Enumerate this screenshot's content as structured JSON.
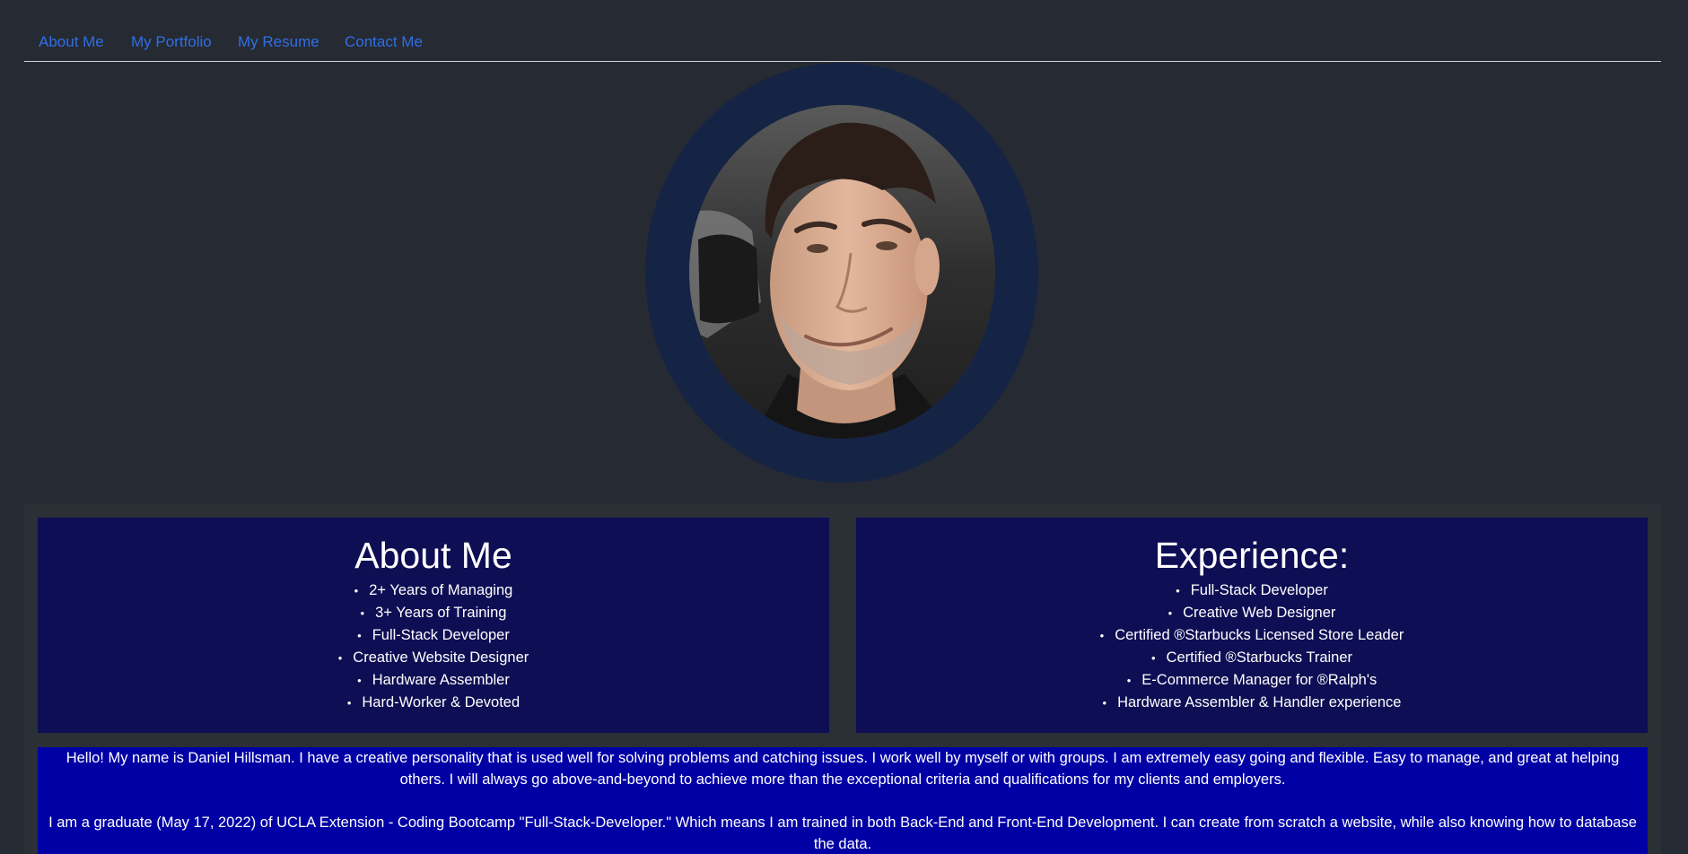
{
  "nav": {
    "links": [
      {
        "label": "About Me"
      },
      {
        "label": "My Portfolio"
      },
      {
        "label": "My Resume"
      },
      {
        "label": "Contact Me"
      }
    ]
  },
  "about": {
    "title": "About Me",
    "items": [
      "2+ Years of Managing",
      "3+ Years of Training",
      "Full-Stack Developer",
      "Creative Website Designer",
      "Hardware Assembler",
      "Hard-Worker & Devoted"
    ]
  },
  "experience": {
    "title": "Experience:",
    "items": [
      "Full-Stack Developer",
      "Creative Web Designer",
      "Certified ®Starbucks Licensed Store Leader",
      "Certified ®Starbucks Trainer",
      "E-Commerce Manager for ®Ralph's",
      "Hardware Assembler & Handler experience"
    ]
  },
  "bio": {
    "paragraph_1": "Hello! My name is Daniel Hillsman. I have a creative personality that is used well for solving problems and catching issues. I work well by myself or with groups. I am extremely easy going and flexible. Easy to manage, and great at helping others. I will always go above-and-beyond to achieve more than the exceptional criteria and qualifications for my clients and employers.",
    "paragraph_2": "I am a graduate (May 17, 2022) of UCLA Extension - Coding Bootcamp \"Full-Stack-Developer.\" Which means I am trained in both Back-End and Front-End Development. I can create from scratch a website, while also knowing how to database the data."
  },
  "colors": {
    "page_bg": "#262a33",
    "nav_link": "#2f6fe6",
    "avatar_ring": "#152345",
    "card_bg": "#0e0e55",
    "bio_bg": "#0000a5"
  }
}
